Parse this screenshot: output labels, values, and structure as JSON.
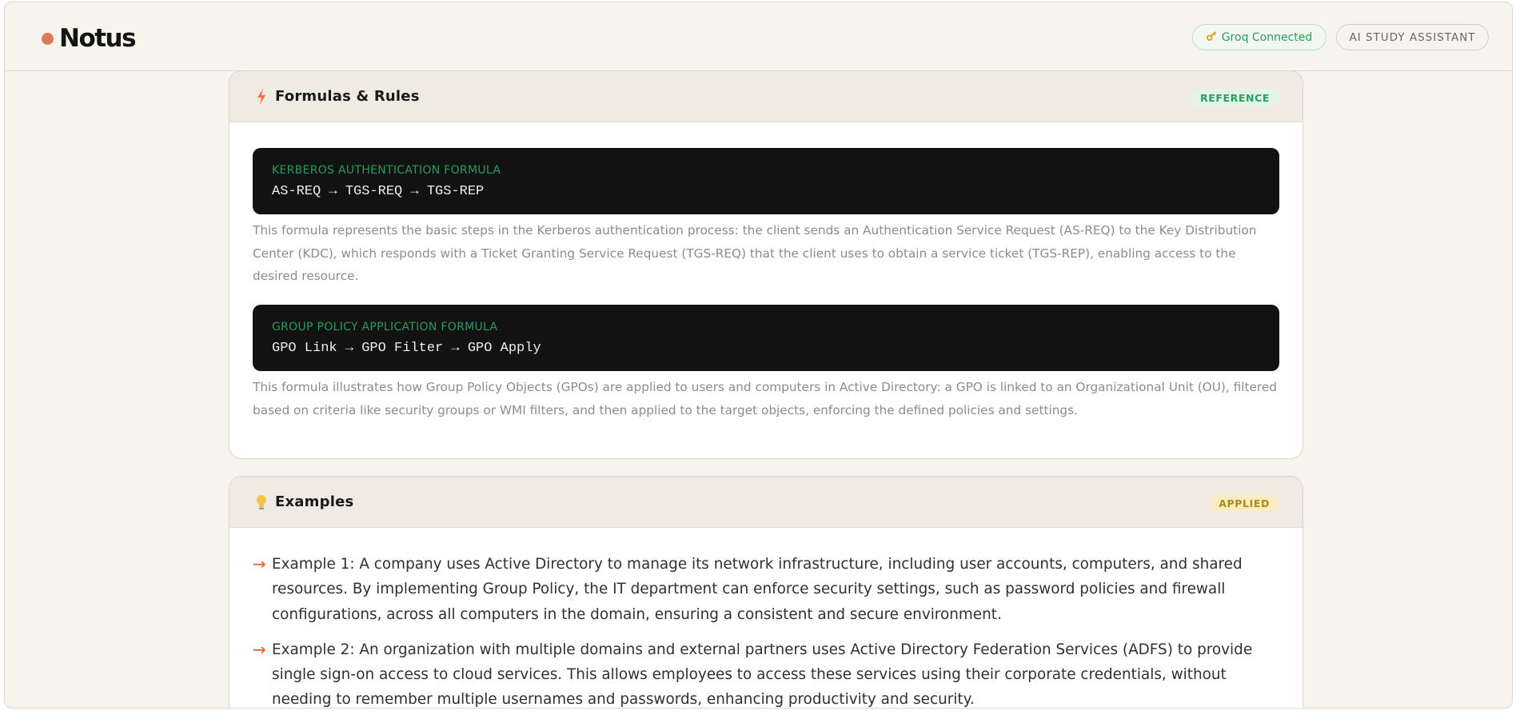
{
  "header": {
    "brand_name": "Notus",
    "groq_status": "Groq Connected",
    "mode_label": "AI STUDY ASSISTANT"
  },
  "formulas": {
    "title": "Formulas & Rules",
    "badge": "REFERENCE",
    "items": [
      {
        "label": "KERBEROS AUTHENTICATION FORMULA",
        "formula": "AS-REQ → TGS-REQ → TGS-REP",
        "description": "This formula represents the basic steps in the Kerberos authentication process: the client sends an Authentication Service Request (AS-REQ) to the Key Distribution Center (KDC), which responds with a Ticket Granting Service Request (TGS-REQ) that the client uses to obtain a service ticket (TGS-REP), enabling access to the desired resource."
      },
      {
        "label": "GROUP POLICY APPLICATION FORMULA",
        "formula": "GPO Link → GPO Filter → GPO Apply",
        "description": "This formula illustrates how Group Policy Objects (GPOs) are applied to users and computers in Active Directory: a GPO is linked to an Organizational Unit (OU), filtered based on criteria like security groups or WMI filters, and then applied to the target objects, enforcing the defined policies and settings."
      }
    ]
  },
  "examples": {
    "title": "Examples",
    "badge": "APPLIED",
    "arrow": "→",
    "items": [
      "Example 1: A company uses Active Directory to manage its network infrastructure, including user accounts, computers, and shared resources. By implementing Group Policy, the IT department can enforce security settings, such as password policies and firewall configurations, across all computers in the domain, ensuring a consistent and secure environment.",
      "Example 2: An organization with multiple domains and external partners uses Active Directory Federation Services (ADFS) to provide single sign-on access to cloud services. This allows employees to access these services using their corporate credentials, without needing to remember multiple usernames and passwords, enhancing productivity and security."
    ]
  },
  "colors": {
    "accent": "#e07a55",
    "success": "#2a9a5c",
    "applied": "#b08a10",
    "arrow": "#e55a2a"
  },
  "icons": {
    "groq": "key-icon",
    "formulas": "lightning-icon",
    "examples": "lightbulb-icon"
  }
}
